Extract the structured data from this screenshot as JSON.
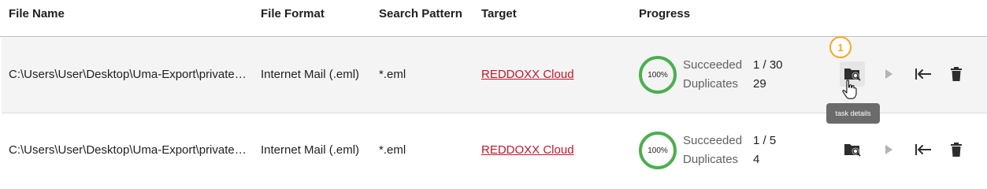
{
  "header": {
    "file_name": "File Name",
    "file_format": "File Format",
    "search_pattern": "Search Pattern",
    "target": "Target",
    "progress": "Progress"
  },
  "rows": [
    {
      "file_name": "C:\\Users\\User\\Desktop\\Uma-Export\\private…",
      "file_format": "Internet Mail (.eml)",
      "search_pattern": "*.eml",
      "target": "REDDOXX Cloud",
      "progress": "100%",
      "succeeded_label": "Succeeded",
      "succeeded_value": "1 / 30",
      "duplicates_label": "Duplicates",
      "duplicates_value": "29"
    },
    {
      "file_name": "C:\\Users\\User\\Desktop\\Uma-Export\\private…",
      "file_format": "Internet Mail (.eml)",
      "search_pattern": "*.eml",
      "target": "REDDOXX Cloud",
      "progress": "100%",
      "succeeded_label": "Succeeded",
      "succeeded_value": "1 / 5",
      "duplicates_label": "Duplicates",
      "duplicates_value": "4"
    }
  ],
  "actions": {
    "details_icon": "folder-search-icon",
    "play_icon": "play-icon",
    "first_icon": "arrow-left-to-line-icon",
    "delete_icon": "trash-icon"
  },
  "step_badge": "1",
  "tooltip": "task details",
  "colors": {
    "progress_ring": "#4caf50",
    "target_link": "#c0162e",
    "badge": "#f5a623"
  }
}
